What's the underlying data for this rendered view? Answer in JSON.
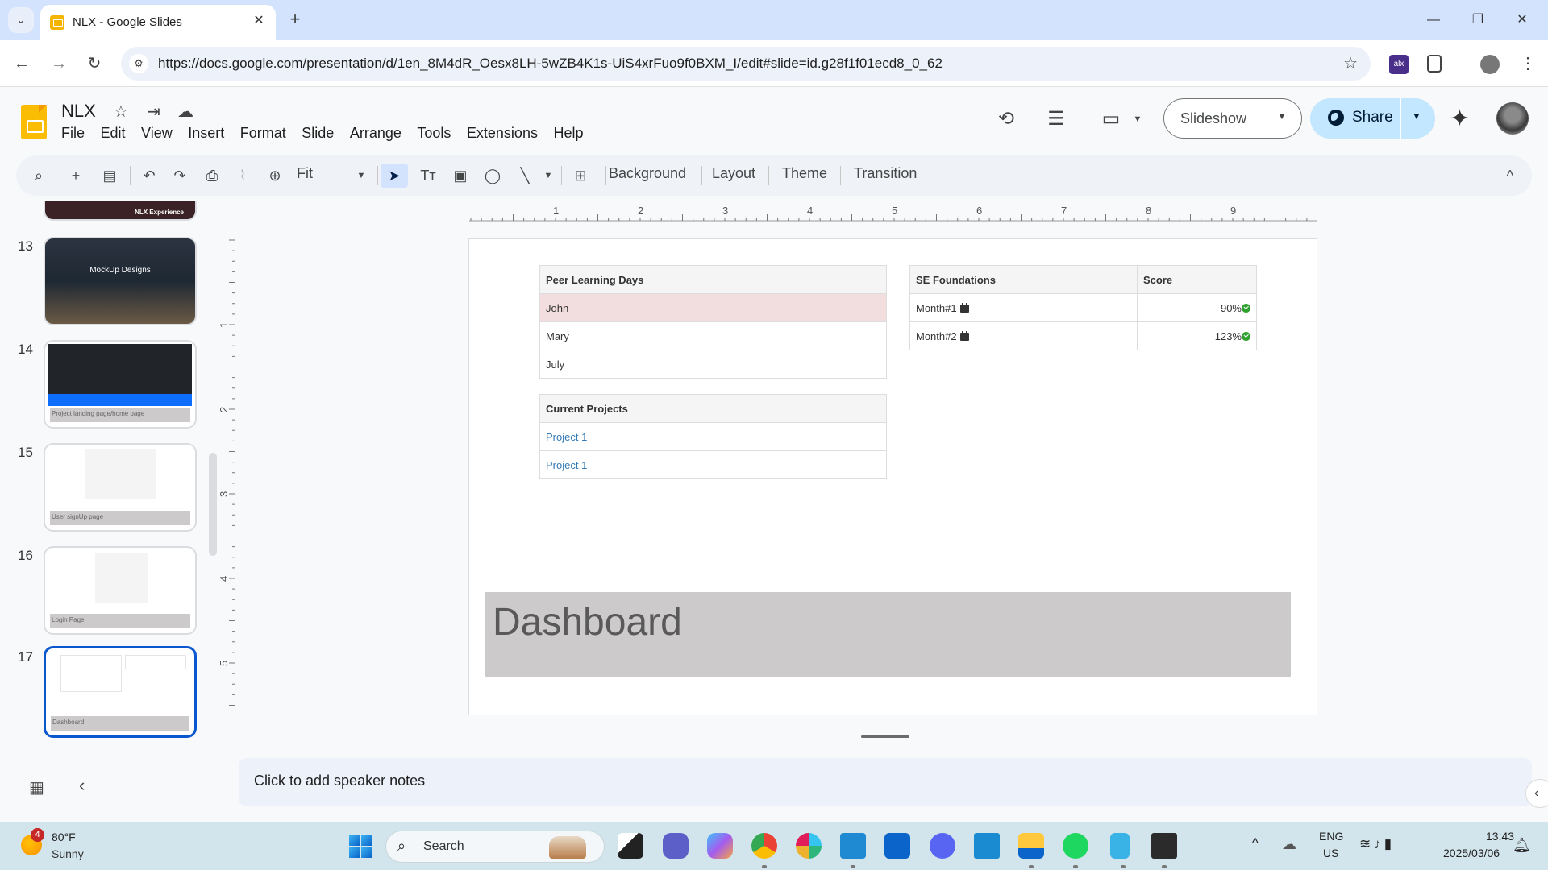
{
  "browser": {
    "tab_title": "NLX - Google Slides",
    "url": "https://docs.google.com/presentation/d/1en_8M4dR_Oesx8LH-5wZB4K1s-UiS4xrFuo9f0BXM_I/edit#slide=id.g28f1f01ecd8_0_62",
    "icons": {
      "tab_list": "⌄",
      "close": "✕",
      "new_tab": "+",
      "back": "←",
      "forward": "→",
      "reload": "↻",
      "site_settings": "⚙",
      "bookmark": "☆",
      "minimize": "—",
      "restore": "❐",
      "close_window": "✕",
      "menu": "⋮"
    }
  },
  "app": {
    "doc_title": "NLX",
    "title_icons": {
      "star": "☆",
      "move": "⇥",
      "cloud": "☁"
    },
    "menu": [
      "File",
      "Edit",
      "View",
      "Insert",
      "Format",
      "Slide",
      "Arrange",
      "Tools",
      "Extensions",
      "Help"
    ],
    "header_icons": {
      "history": "⟲",
      "comments": "☰",
      "meet": "▭",
      "gemini": "✦"
    },
    "slideshow_label": "Slideshow",
    "share_label": "Share",
    "accent_color": "#c2e7ff"
  },
  "toolbar": {
    "zoom_value": "Fit",
    "buttons": [
      "Background",
      "Layout",
      "Theme",
      "Transition"
    ],
    "icons": {
      "search": "⌕",
      "new_slide": "+",
      "layout_tool": "▤",
      "undo": "↶",
      "redo": "↷",
      "print": "⎙",
      "paint_format": "⌇",
      "zoom": "⊕",
      "select": "➤",
      "text_box": "Tт",
      "image": "▣",
      "shape": "◯",
      "line": "╲",
      "comment": "⊞",
      "collapse": "^"
    }
  },
  "filmstrip": {
    "slides": [
      {
        "number": "",
        "caption": "NLX Experience"
      },
      {
        "number": "13",
        "caption": "MockUp Designs"
      },
      {
        "number": "14",
        "caption": "Project landing page/home page"
      },
      {
        "number": "15",
        "caption": "User signUp page"
      },
      {
        "number": "16",
        "caption": "Login Page"
      },
      {
        "number": "17",
        "caption": "Dashboard"
      }
    ],
    "selected": "17"
  },
  "rulers": {
    "horizontal": [
      "1",
      "2",
      "3",
      "4",
      "5",
      "6",
      "7",
      "8",
      "9"
    ],
    "vertical": [
      "1",
      "2",
      "3",
      "4",
      "5"
    ]
  },
  "slide": {
    "peer_table": {
      "header": "Peer Learning Days",
      "rows": [
        "John",
        "Mary",
        "July"
      ],
      "highlight_color": "#f2dede"
    },
    "projects_table": {
      "header": "Current Projects",
      "rows": [
        "Project 1",
        "Project 1"
      ],
      "link_color": "#337ab7"
    },
    "se_table": {
      "headers": [
        "SE Foundations",
        "Score"
      ],
      "rows": [
        {
          "label": "Month#1",
          "score": "90%"
        },
        {
          "label": "Month#2",
          "score": "123%"
        }
      ],
      "check_color": "#2fa12f"
    },
    "title": "Dashboard"
  },
  "notes": {
    "placeholder": "Click to add speaker notes"
  },
  "taskbar": {
    "weather_temp": "80°F",
    "weather_cond": "Sunny",
    "weather_badge": "4",
    "search_label": "Search",
    "apps": [
      "Task View",
      "Teams",
      "Copilot",
      "Chrome",
      "Slack",
      "VS Code",
      "Outlook",
      "Discord",
      "Phone Link",
      "File Explorer",
      "Spotify",
      "Notepad",
      "Terminal"
    ],
    "lang_1": "ENG",
    "lang_2": "US",
    "time": "13:43",
    "date": "2025/03/06"
  }
}
